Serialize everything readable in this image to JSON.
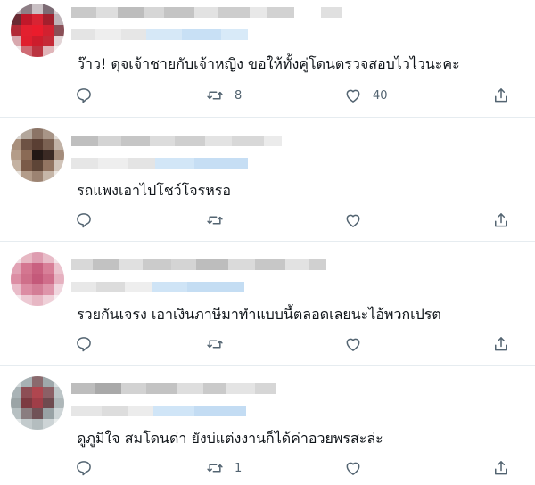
{
  "tweets": [
    {
      "text": "ว๊าว! ดุจเจ้าชายกับเจ้าหญิง ขอให้ทั้งคู่โดนตรวจสอบไวไวนะคะ",
      "retweets": "8",
      "likes": "40"
    },
    {
      "text": "รถแพงเอาไปโชว์โจรหรอ",
      "retweets": "",
      "likes": ""
    },
    {
      "text": "รวยกันเจรง เอาเงินภาษีมาทำแบบนี้ตลอดเลยนะไอ้พวกเปรต",
      "retweets": "",
      "likes": ""
    },
    {
      "text": "ดูภูมิใจ สมโดนด่า ยังบ่แต่งงานก็ได้ค่าอวยพรสะล่ะ",
      "retweets": "1",
      "likes": ""
    }
  ],
  "icons": {
    "reply": "reply-icon",
    "retweet": "retweet-icon",
    "like": "heart-icon",
    "share": "share-icon"
  },
  "colors": {
    "icon": "#536471",
    "divider": "#e6ecf0",
    "text": "#0f1419"
  }
}
